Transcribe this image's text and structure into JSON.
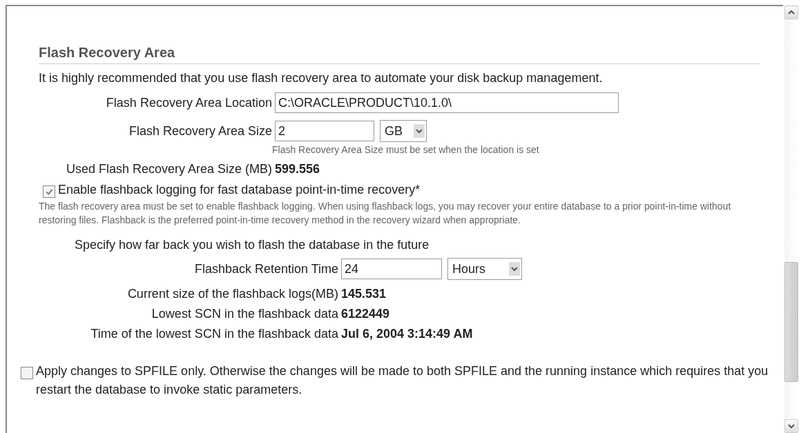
{
  "section": {
    "title": "Flash Recovery Area",
    "intro": "It is highly recommended that you use flash recovery area to automate your disk backup management."
  },
  "location": {
    "label": "Flash Recovery Area Location",
    "value": "C:\\ORACLE\\PRODUCT\\10.1.0\\"
  },
  "size": {
    "label": "Flash Recovery Area Size",
    "value": "2",
    "unit": "GB",
    "hint": "Flash Recovery Area Size must be set when the location is set"
  },
  "used": {
    "label": "Used Flash Recovery Area Size (MB)",
    "value": "599.556"
  },
  "flashback": {
    "label": "Enable flashback logging for fast database point-in-time recovery*",
    "checked": true,
    "description": "The flash recovery area must be set to enable flashback logging. When using flashback logs, you may recover your entire database to a prior point-in-time without restoring files. Flashback is the preferred point-in-time recovery method in the recovery wizard when appropriate."
  },
  "retention": {
    "intro": "Specify how far back you wish to flash the database in the future",
    "label": "Flashback Retention Time",
    "value": "24",
    "unit": "Hours"
  },
  "stats": [
    {
      "label": "Current size of the flashback logs(MB)",
      "value": "145.531"
    },
    {
      "label": "Lowest SCN in the flashback data",
      "value": "6122449"
    },
    {
      "label": "Time of the lowest SCN in the flashback data",
      "value": "Jul 6, 2004 3:14:49 AM"
    }
  ],
  "spfile": {
    "label": "Apply changes to SPFILE only. Otherwise the changes will be made to both SPFILE and the running instance which requires that you restart the database to invoke static parameters.",
    "checked": false
  }
}
